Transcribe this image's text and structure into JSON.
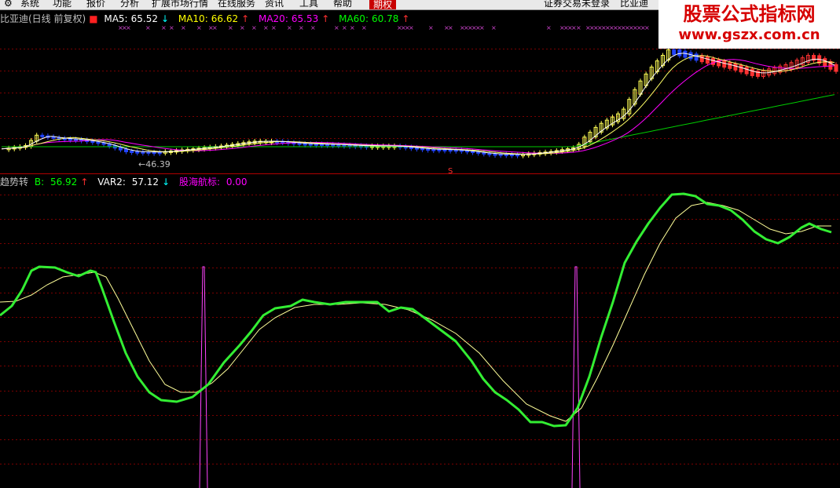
{
  "menu": {
    "items": [
      "系统",
      "功能",
      "报价",
      "分析",
      "扩展市场行情",
      "在线服务",
      "资讯",
      "工具",
      "帮助"
    ],
    "active_tab": "期权",
    "right_items": [
      "证券交易未登录",
      "比亚迪"
    ]
  },
  "upper_pane": {
    "stock_title": "比亚迪(日线 前复权)",
    "ma": [
      {
        "label": "MA5:",
        "value": "65.52",
        "arrow": "↓",
        "color": "#ffffff"
      },
      {
        "label": "MA10:",
        "value": "66.62",
        "arrow": "↑",
        "color": "#ffff00"
      },
      {
        "label": "MA20:",
        "value": "65.53",
        "arrow": "↑",
        "color": "#ff00ff"
      },
      {
        "label": "MA60:",
        "value": "60.78",
        "arrow": "↑",
        "color": "#00ff00"
      }
    ],
    "low_marker": "←46.39",
    "signal_mark": "S"
  },
  "lower_pane": {
    "indicator_name": "趋势转",
    "values": [
      {
        "label": "B:",
        "value": "56.92",
        "arrow": "↑",
        "color": "#00ff00"
      },
      {
        "label": "VAR2:",
        "value": "57.12",
        "arrow": "↓",
        "color": "#ffffff"
      },
      {
        "label": "股海航标:",
        "value": "0.00",
        "arrow": "",
        "color": "#ff00ff"
      }
    ]
  },
  "watermark": {
    "line1": "股票公式指标网",
    "line2": "www.gszx.com.cn"
  },
  "colors": {
    "background": "#000000",
    "grid": "#8b0000",
    "up_candle": "#ffff00",
    "down_candle": "#0000ff",
    "b_line": "#00ff00",
    "var2_line": "#ffff99",
    "signal": "#ff00ff"
  }
}
